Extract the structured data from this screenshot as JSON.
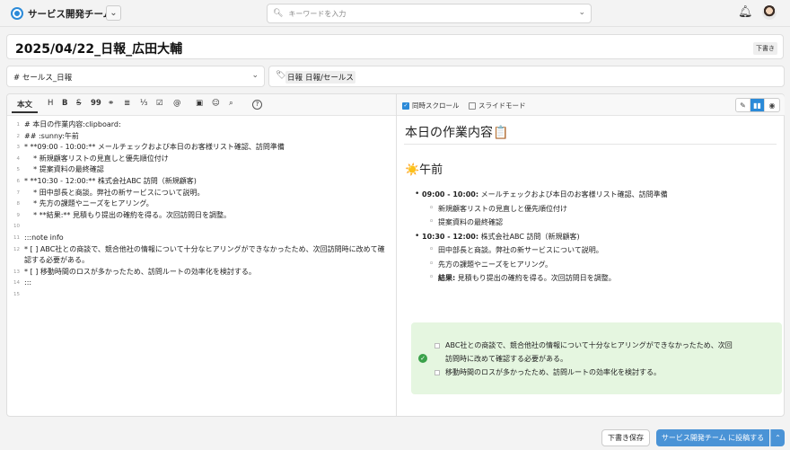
{
  "header": {
    "team_name": "サービス開発チーム",
    "team_dropdown_icon": "chevron-down-icon",
    "search_placeholder": "キーワードを入力",
    "search_icon": "search-icon",
    "bell_icon": "bell-icon"
  },
  "title": {
    "text": "2025/04/22_日報_広田大輔",
    "draft_badge": "下書き"
  },
  "channel": {
    "value": "# セールス_日報"
  },
  "tags": {
    "items": [
      "日報",
      "日報/セールス"
    ]
  },
  "toolbar": {
    "body_tab": "本文",
    "h": "H",
    "b": "B",
    "strike": "S",
    "quote": "99",
    "link": "⚭",
    "ul": "≣",
    "ol": "⅓",
    "check": "☑",
    "mention": "@",
    "image": "▣",
    "emoji": "☺",
    "find": "⌕",
    "help": "?"
  },
  "preview_toolbar": {
    "sync_scroll": "同時スクロール",
    "sync_scroll_checked": true,
    "slide_mode": "スライドモード",
    "slide_mode_checked": false
  },
  "editor": {
    "lines": [
      {
        "n": "1",
        "t": "# 本日の作業内容:clipboard:"
      },
      {
        "n": "2",
        "t": "## :sunny:午前"
      },
      {
        "n": "3",
        "t": "* **09:00 - 10:00:** メールチェックおよび本日のお客様リスト確認、訪問準備"
      },
      {
        "n": "4",
        "t": "    * 新規顧客リストの見直しと優先順位付け"
      },
      {
        "n": "5",
        "t": "    * 提案資料の最終確認"
      },
      {
        "n": "6",
        "t": "* **10:30 - 12:00:** 株式会社ABC 訪問（新規顧客)"
      },
      {
        "n": "7",
        "t": "    * 田中部長と商談。弊社の新サービスについて説明。"
      },
      {
        "n": "8",
        "t": "    * 先方の課題やニーズをヒアリング。"
      },
      {
        "n": "9",
        "t": "    * **結果:** 見積もり提出の確約を得る。次回訪問日を調整。"
      },
      {
        "n": "10",
        "t": ""
      },
      {
        "n": "11",
        "t": ":::note info"
      },
      {
        "n": "12",
        "t": "* [ ] ABC社との商談で、競合他社の情報について十分なヒアリングができなかったため、次回訪問時に改めて確認する必要がある。"
      },
      {
        "n": "13",
        "t": "* [ ] 移動時間のロスが多かったため、訪問ルートの効率化を検討する。"
      },
      {
        "n": "14",
        "t": ":::"
      },
      {
        "n": "15",
        "t": ""
      }
    ]
  },
  "preview": {
    "h1": "本日の作業内容📋",
    "h2": "☀️午前",
    "items": [
      {
        "level": 1,
        "bold": "09:00 - 10:00:",
        "text": " メールチェックおよび本日のお客様リスト確認、訪問準備"
      },
      {
        "level": 2,
        "bold": "",
        "text": "新規顧客リストの見直しと優先順位付け"
      },
      {
        "level": 2,
        "bold": "",
        "text": "提案資料の最終確認"
      },
      {
        "level": 1,
        "bold": "10:30 - 12:00:",
        "text": " 株式会社ABC 訪問（新規顧客)"
      },
      {
        "level": 2,
        "bold": "",
        "text": "田中部長と商談。弊社の新サービスについて説明。"
      },
      {
        "level": 2,
        "bold": "",
        "text": "先方の課題やニーズをヒアリング。"
      },
      {
        "level": 2,
        "bold": "結果:",
        "text": " 見積もり提出の確約を得る。次回訪問日を調整。"
      }
    ],
    "note": {
      "line1": "ABC社との商談で、競合他社の情報について十分なヒアリングができなかったため、次回",
      "line2": "訪問時に改めて確認する必要がある。",
      "line3": "移動時間のロスが多かったため、訪問ルートの効率化を検討する。"
    }
  },
  "footer": {
    "save_draft": "下書き保存",
    "post_label": "サービス開発チーム に投稿する"
  },
  "colors": {
    "accent": "#4a93d6",
    "note_bg": "#e5f6e0",
    "note_icon": "#3aa14a"
  }
}
